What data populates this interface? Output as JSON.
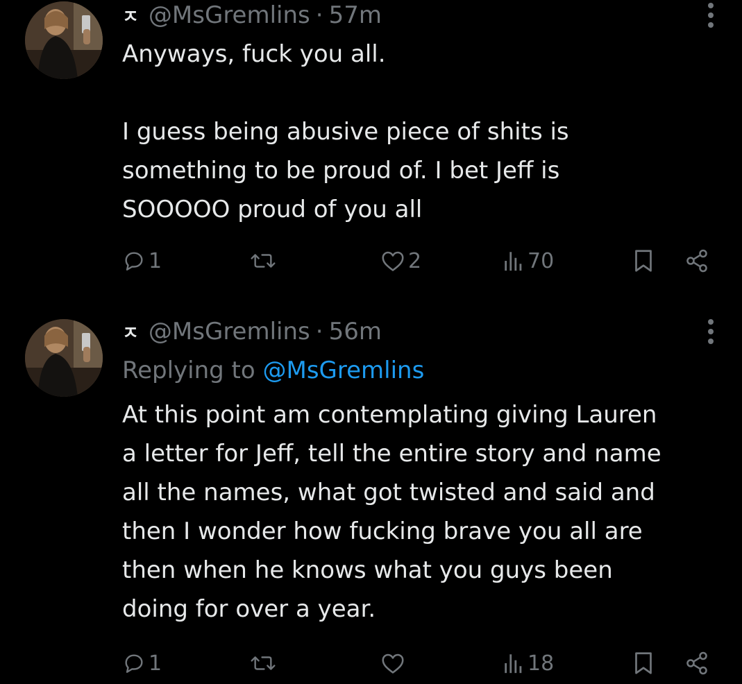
{
  "tweets": [
    {
      "author_badge": "ㅈ",
      "handle": "@MsGremlins",
      "separator": "·",
      "time": "57m",
      "reply_prefix": "",
      "reply_handle": "",
      "text": "Anyways, fuck you all.\n\nI guess being abusive piece of shits is\nsomething to be proud of. I bet Jeff is\nSOOOOO proud of you all",
      "replies": "1",
      "retweets": "",
      "likes": "2",
      "views": "70"
    },
    {
      "author_badge": "ㅈ",
      "handle": "@MsGremlins",
      "separator": "·",
      "time": "56m",
      "reply_prefix": "Replying to ",
      "reply_handle": "@MsGremlins",
      "text": "At this point am contemplating giving Lauren\na letter for Jeff, tell the entire story and name\nall the names, what got twisted and said and\nthen I wonder how fucking brave you all are\nthen when he knows what you guys been\ndoing for over a year.",
      "replies": "1",
      "retweets": "",
      "likes": "",
      "views": "18"
    }
  ],
  "icons": {
    "reply": "reply-icon",
    "retweet": "retweet-icon",
    "like": "heart-icon",
    "views": "views-icon",
    "bookmark": "bookmark-icon",
    "share": "share-icon",
    "more": "more-icon"
  },
  "colors": {
    "background": "#000000",
    "text": "#e7e9ea",
    "muted": "#71767b",
    "link": "#1d9bf0"
  }
}
